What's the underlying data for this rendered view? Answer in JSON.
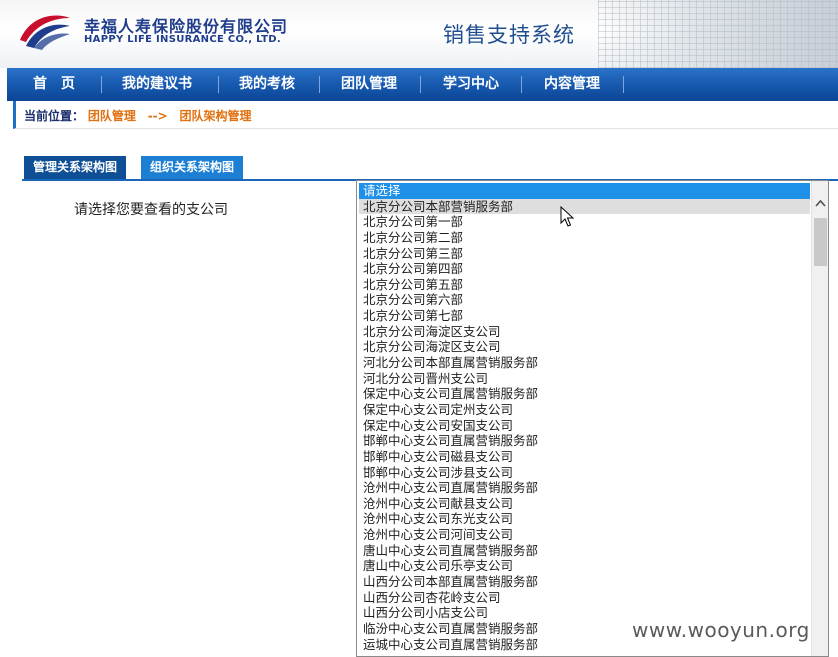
{
  "header": {
    "logo_cn": "幸福人寿保险股份有限公司",
    "logo_en": "HAPPY LIFE INSURANCE CO., LTD.",
    "system_title": "销售支持系统"
  },
  "nav": {
    "items": [
      {
        "label": "首　页"
      },
      {
        "label": "我的建议书"
      },
      {
        "label": "我的考核"
      },
      {
        "label": "团队管理"
      },
      {
        "label": "学习中心"
      },
      {
        "label": "内容管理"
      }
    ]
  },
  "breadcrumb": {
    "label": "当前位置：",
    "path": [
      "团队管理",
      "团队架构管理"
    ],
    "arrow": "-->"
  },
  "tabs": [
    {
      "label": "管理关系架构图"
    },
    {
      "label": "组织关系架构图"
    }
  ],
  "prompt": "请选择您要查看的支公司",
  "branch_list": {
    "selected_index": 0,
    "hovered_index": 1,
    "options": [
      "请选择",
      "北京分公司本部营销服务部",
      "北京分公司第一部",
      "北京分公司第二部",
      "北京分公司第三部",
      "北京分公司第四部",
      "北京分公司第五部",
      "北京分公司第六部",
      "北京分公司第七部",
      "北京分公司海淀区支公司",
      "北京分公司海淀区支公司",
      "河北分公司本部直属营销服务部",
      "河北分公司晋州支公司",
      "保定中心支公司直属营销服务部",
      "保定中心支公司定州支公司",
      "保定中心支公司安国支公司",
      "邯郸中心支公司直属营销服务部",
      "邯郸中心支公司磁县支公司",
      "邯郸中心支公司涉县支公司",
      "沧州中心支公司直属营销服务部",
      "沧州中心支公司献县支公司",
      "沧州中心支公司东光支公司",
      "沧州中心支公司河间支公司",
      "唐山中心支公司直属营销服务部",
      "唐山中心支公司乐亭支公司",
      "山西分公司本部直属营销服务部",
      "山西分公司杏花岭支公司",
      "山西分公司小店支公司",
      "临汾中心支公司直属营销服务部",
      "运城中心支公司直属营销服务部"
    ]
  },
  "watermark": "www.wooyun.org",
  "colors": {
    "nav": "#1557ad",
    "breadcrumb_accent": "#e2700f",
    "tab_active": "#0e4f96",
    "tab_inactive": "#1c7fd3",
    "option_selected": "#1e90e8"
  }
}
